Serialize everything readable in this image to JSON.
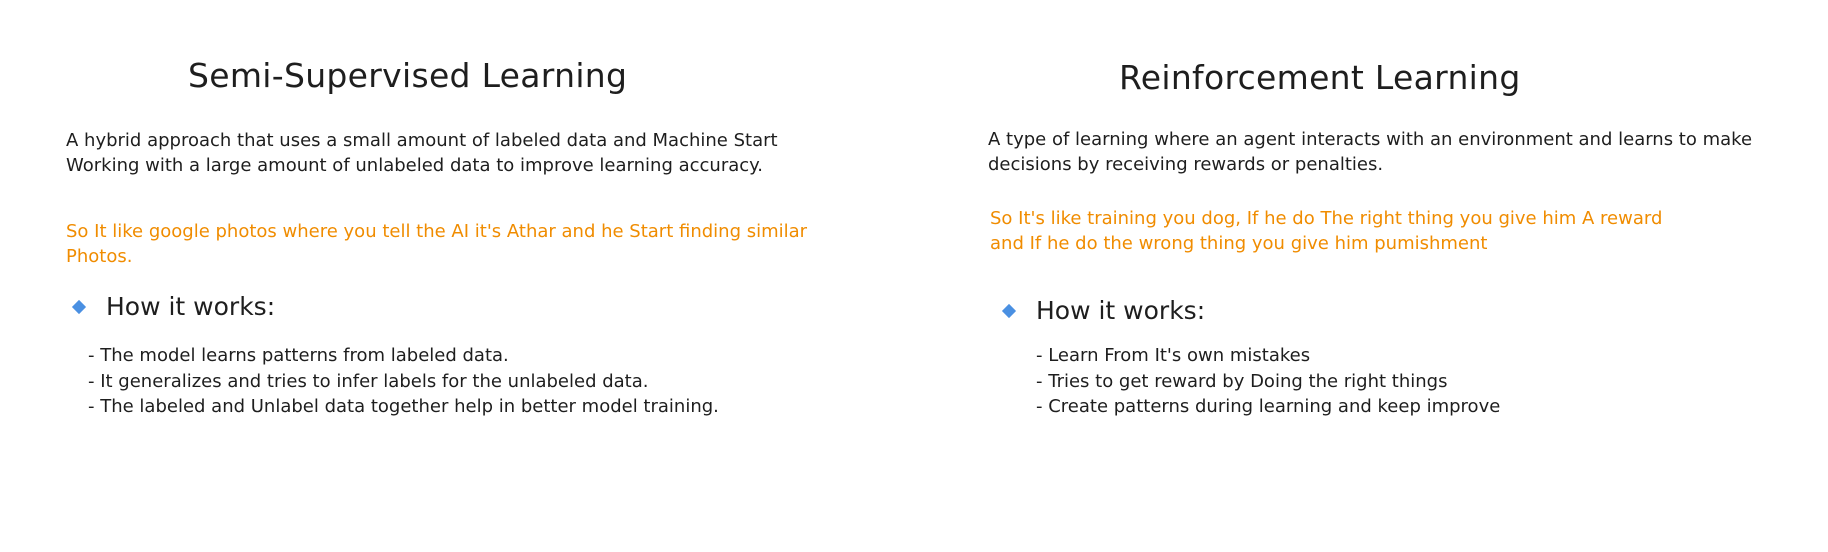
{
  "left": {
    "title": "Semi-Supervised Learning",
    "description": "A hybrid approach that uses a small amount of labeled data and Machine Start Working with a large amount of unlabeled data to improve learning accuracy.",
    "example": "So It like google photos where you tell the AI it's Athar and he Start finding similar Photos.",
    "how_label": "How it works:",
    "points": [
      "- The model learns patterns from labeled data.",
      "- It generalizes and tries to infer labels for the unlabeled data.",
      "- The labeled and Unlabel data together help in better model training."
    ]
  },
  "right": {
    "title": "Reinforcement Learning",
    "description": "A type of learning where an agent interacts with an environment and learns to make decisions by receiving rewards or penalties.",
    "example": "So It's like training you dog, If he do The right thing you give him A reward and If he do the wrong thing you give him pumishment",
    "how_label": "How it works:",
    "points": [
      "- Learn From It's own mistakes",
      "- Tries to get reward by Doing the right things",
      "- Create patterns during learning and keep improve"
    ]
  },
  "colors": {
    "text": "#1e1e1e",
    "example_text": "#f08c00",
    "bullet_icon": "#4a90e2"
  },
  "icons": {
    "bullet": "diamond-icon"
  }
}
